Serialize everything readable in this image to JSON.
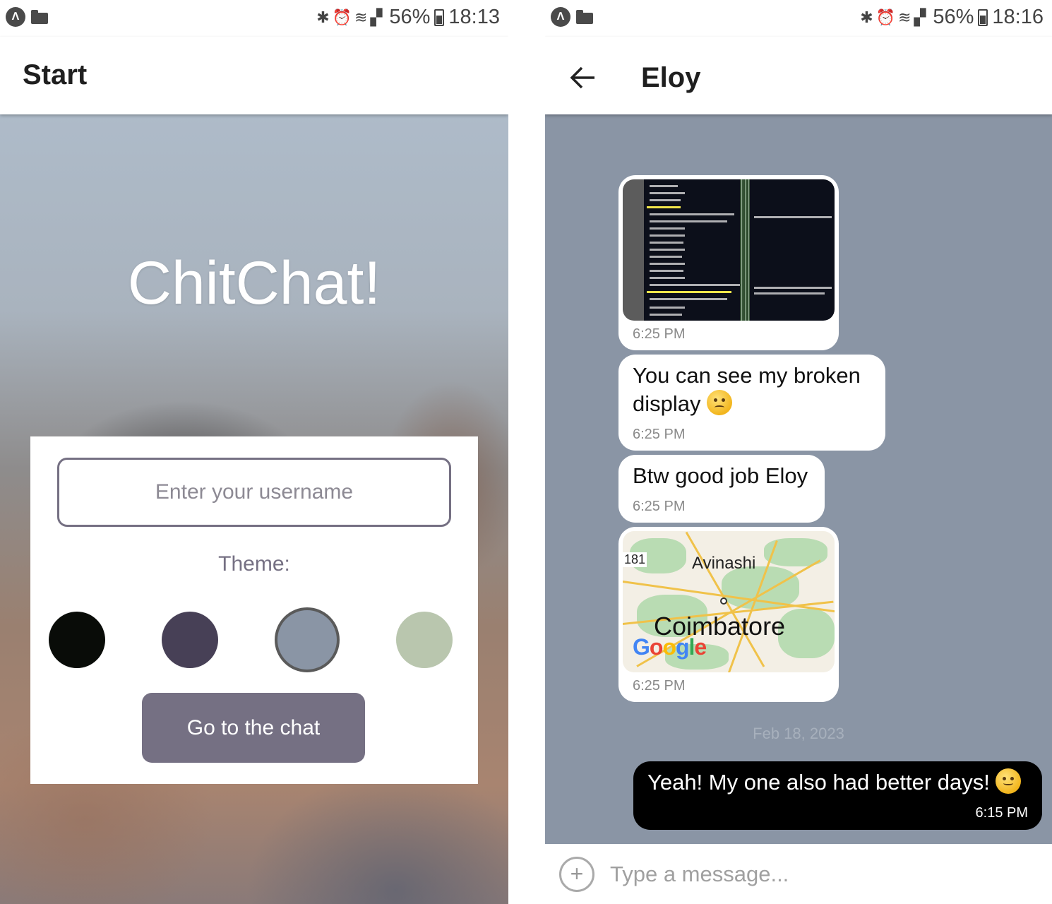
{
  "start_screen": {
    "status_bar": {
      "battery": "56%",
      "time": "18:13"
    },
    "app_bar": {
      "title": "Start"
    },
    "app_name": "ChitChat!",
    "username": {
      "placeholder": "Enter your username",
      "value": ""
    },
    "theme_label": "Theme:",
    "theme_colors": [
      "#090C08",
      "#474056",
      "#8A95A5",
      "#B9C6AE"
    ],
    "selected_theme": "#8A95A5",
    "go_button": "Go to the chat"
  },
  "chat_screen": {
    "status_bar": {
      "battery": "56%",
      "time": "18:16"
    },
    "app_bar": {
      "title": "Eloy"
    },
    "messages": [
      {
        "type": "image",
        "time": "6:25 PM"
      },
      {
        "type": "text",
        "line1": "You can see my broken",
        "line2": "display",
        "time": "6:25 PM"
      },
      {
        "type": "text",
        "text": "Btw good job Eloy",
        "time": "6:25 PM"
      },
      {
        "type": "map",
        "labels": {
          "route": "181",
          "town": "Avinashi",
          "city": "Coimbatore"
        },
        "time": "6:25 PM"
      }
    ],
    "date_separator": "Feb 18, 2023",
    "own_message": {
      "text": "Yeah! My one also had better days!",
      "time": "6:15 PM"
    },
    "composer": {
      "placeholder": "Type a message..."
    },
    "colors": {
      "background": "#8A95A5",
      "own_bubble": "#000000"
    }
  }
}
